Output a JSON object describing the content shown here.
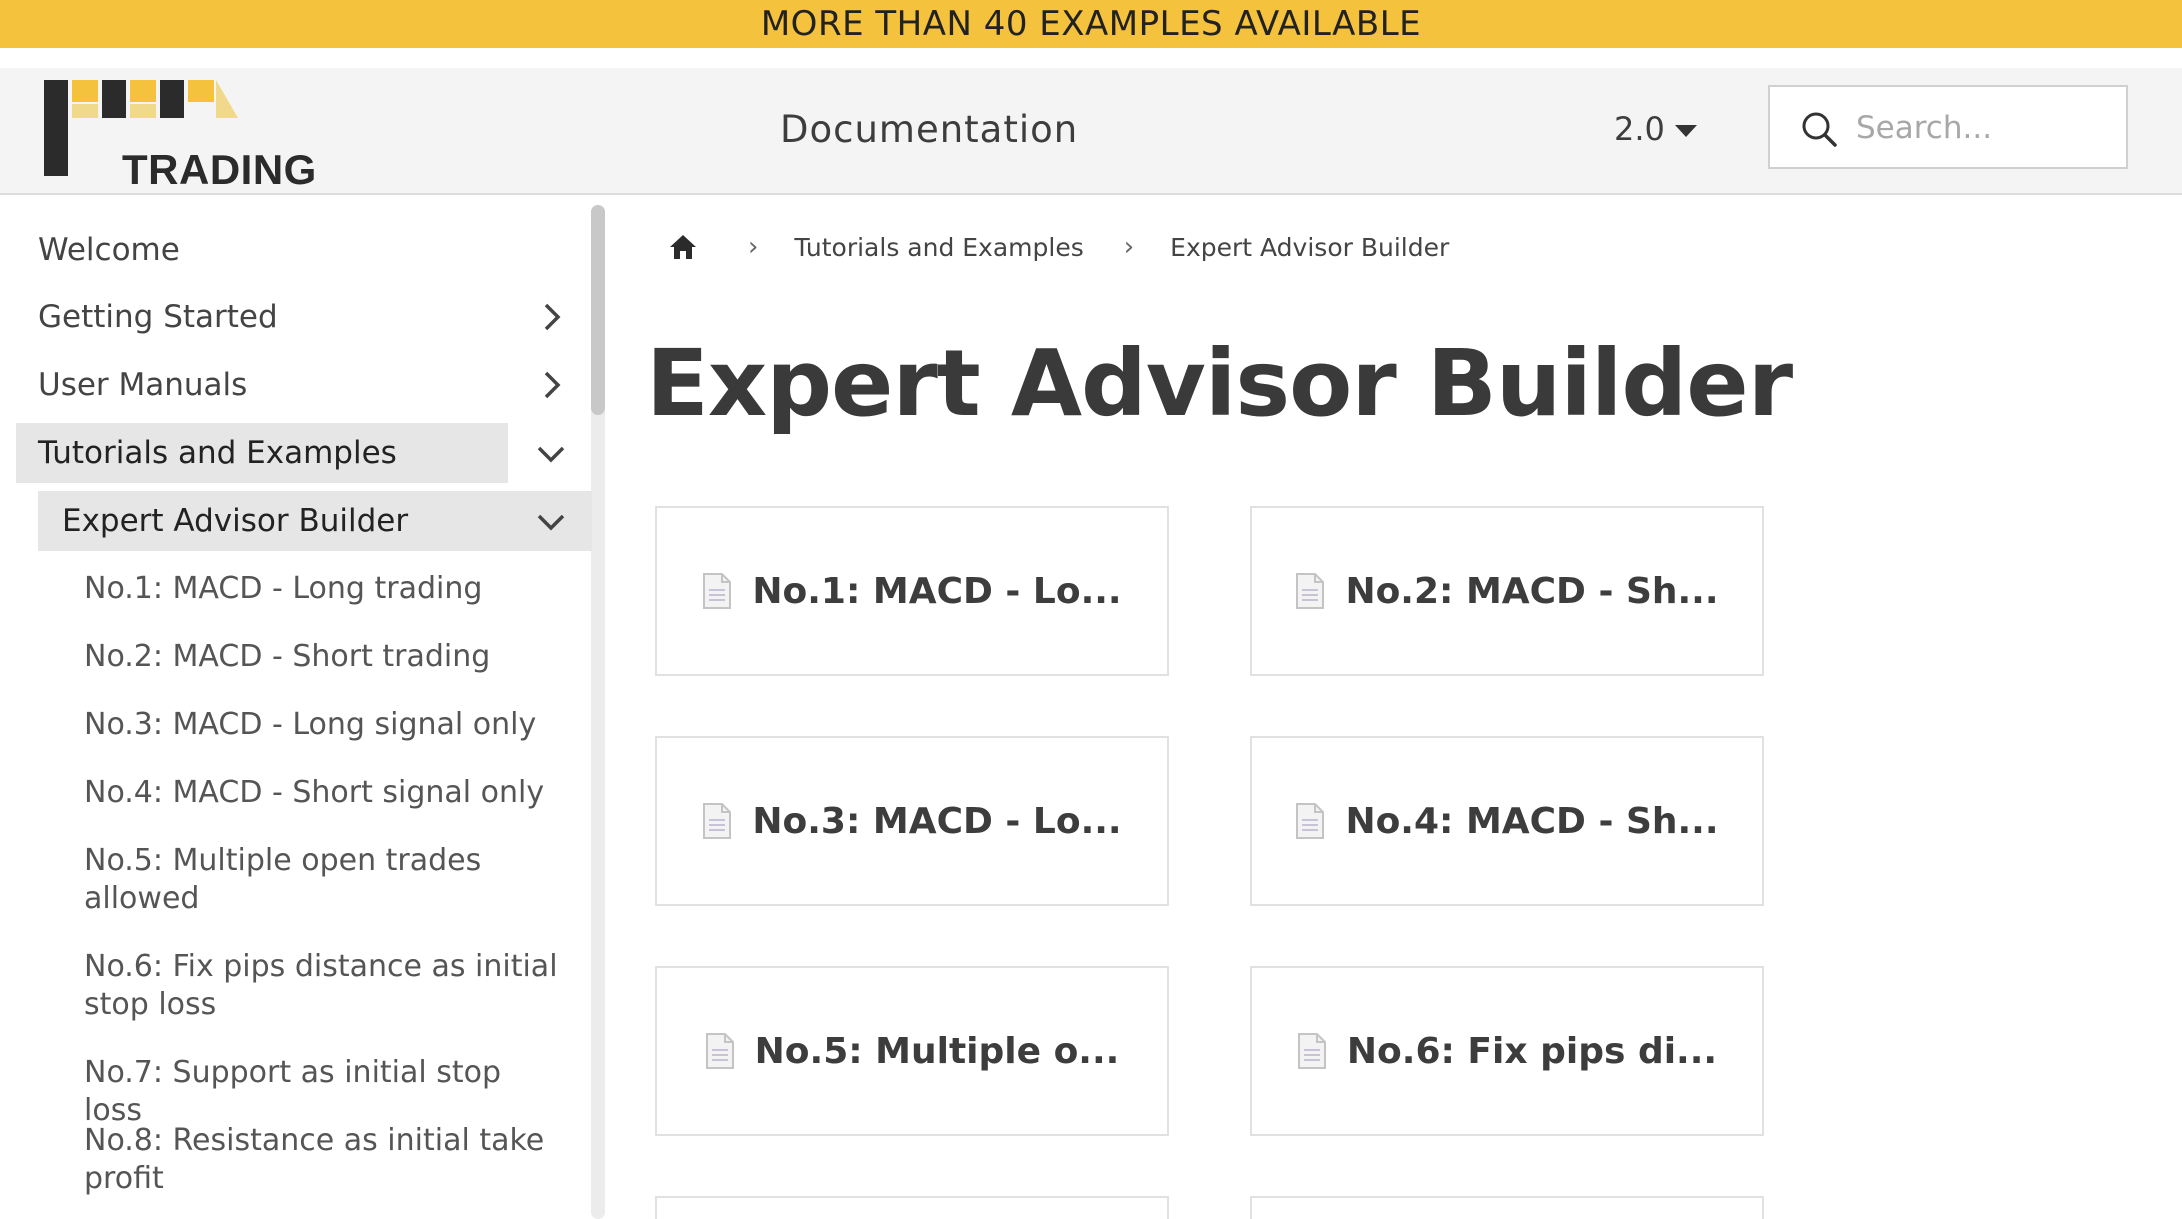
{
  "banner": {
    "text": "MORE THAN 40 EXAMPLES AVAILABLE"
  },
  "header": {
    "logo_text": "TRADING",
    "title": "Documentation",
    "version": "2.0",
    "search_placeholder": "Search..."
  },
  "colors": {
    "accent": "#f5c23e",
    "selected_bg": "#e6e6e6"
  },
  "sidebar": {
    "items": [
      {
        "label": "Welcome"
      },
      {
        "label": "Getting Started"
      },
      {
        "label": "User Manuals"
      },
      {
        "label": "Tutorials and Examples"
      },
      {
        "label": "Expert Advisor Builder"
      }
    ],
    "subitems": [
      "No.1: MACD - Long trading",
      "No.2: MACD - Short trading",
      "No.3: MACD - Long signal only",
      "No.4: MACD - Short signal only",
      "No.5: Multiple open trades allowed",
      "No.6: Fix pips distance as initial stop loss",
      "No.7: Support as initial stop loss",
      "No.8: Resistance as initial take profit"
    ]
  },
  "breadcrumb": {
    "items": [
      "Tutorials and Examples",
      "Expert Advisor Builder"
    ]
  },
  "main": {
    "title": "Expert Advisor Builder",
    "cards": [
      "No.1: MACD - Lo...",
      "No.2: MACD - Sh...",
      "No.3: MACD - Lo...",
      "No.4: MACD - Sh...",
      "No.5: Multiple o...",
      "No.6: Fix pips di..."
    ]
  }
}
